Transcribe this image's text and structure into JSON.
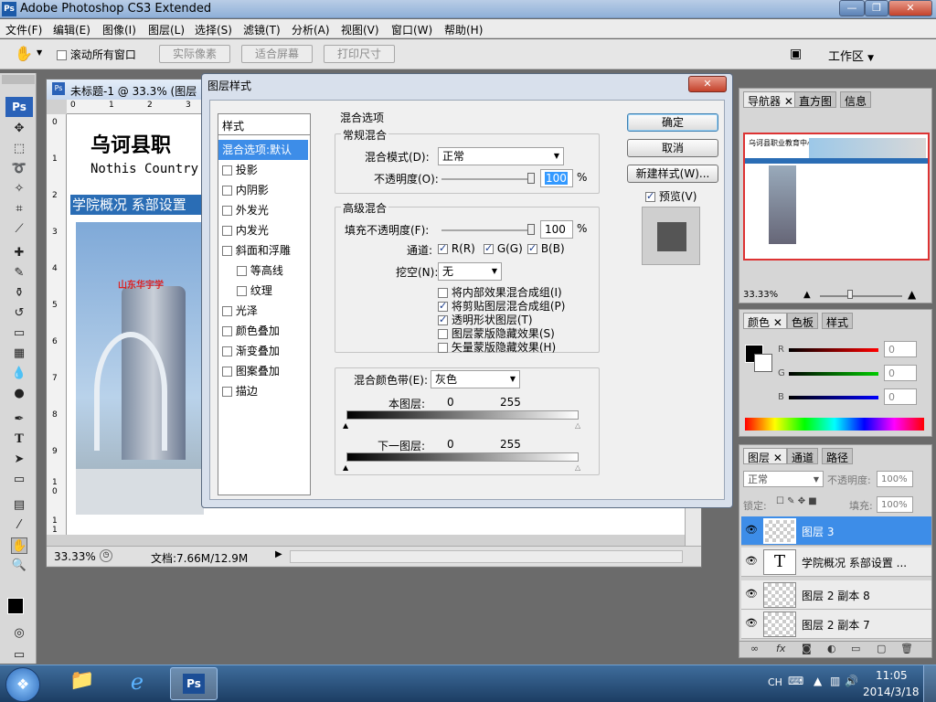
{
  "app": {
    "title": "Adobe Photoshop CS3 Extended",
    "logo": "Ps"
  },
  "window_controls": {
    "minimize": "—",
    "maximize": "❐",
    "close": "✕"
  },
  "menu": [
    "文件(F)",
    "编辑(E)",
    "图像(I)",
    "图层(L)",
    "选择(S)",
    "滤镜(T)",
    "分析(A)",
    "视图(V)",
    "窗口(W)",
    "帮助(H)"
  ],
  "options": {
    "scroll_all": "滚动所有窗口",
    "actual_pixels": "实际像素",
    "fit_screen": "适合屏幕",
    "print_size": "打印尺寸",
    "workspace": "工作区"
  },
  "document": {
    "tab_title": "未标题-1 @ 33.3% (图层",
    "heading_cn": "乌诃县职",
    "heading_en": "Nothis Country",
    "nav_text": "学院概况 系部设置",
    "building_sign": "山东华宇学",
    "zoom": "33.33%",
    "doc_size": "文档:7.66M/12.9M",
    "ruler_top": [
      "0",
      "1",
      "2",
      "3"
    ],
    "ruler_left": [
      "0",
      "1",
      "2",
      "3",
      "4",
      "5",
      "6",
      "7",
      "8",
      "9",
      "1\n0",
      "1\n1"
    ]
  },
  "dialog": {
    "title": "图层样式",
    "styles_header": "样式",
    "style_items": [
      {
        "label": "混合选项:默认",
        "checkbox": false,
        "selected": true
      },
      {
        "label": "投影",
        "checkbox": true
      },
      {
        "label": "内阴影",
        "checkbox": true
      },
      {
        "label": "外发光",
        "checkbox": true
      },
      {
        "label": "内发光",
        "checkbox": true
      },
      {
        "label": "斜面和浮雕",
        "checkbox": true
      },
      {
        "label": "等高线",
        "checkbox": true,
        "indent": true
      },
      {
        "label": "纹理",
        "checkbox": true,
        "indent": true
      },
      {
        "label": "光泽",
        "checkbox": true
      },
      {
        "label": "颜色叠加",
        "checkbox": true
      },
      {
        "label": "渐变叠加",
        "checkbox": true
      },
      {
        "label": "图案叠加",
        "checkbox": true
      },
      {
        "label": "描边",
        "checkbox": true
      }
    ],
    "blend_options": "混合选项",
    "general_blending": "常规混合",
    "blend_mode_label": "混合模式(D):",
    "blend_mode_value": "正常",
    "opacity_label": "不透明度(O):",
    "opacity_value": "100",
    "percent": "%",
    "advanced_blending": "高级混合",
    "fill_opacity_label": "填充不透明度(F):",
    "fill_opacity_value": "100",
    "channels_label": "通道:",
    "channel_r": "R(R)",
    "channel_g": "G(G)",
    "channel_b": "B(B)",
    "knockout_label": "挖空(N):",
    "knockout_value": "无",
    "check1": "将内部效果混合成组(I)",
    "check2": "将剪贴图层混合成组(P)",
    "check3": "透明形状图层(T)",
    "check4": "图层蒙版隐藏效果(S)",
    "check5": "矢量蒙版隐藏效果(H)",
    "blend_if_label": "混合颜色带(E):",
    "blend_if_value": "灰色",
    "this_layer": "本图层:",
    "underlying_layer": "下一图层:",
    "range_min": "0",
    "range_max": "255",
    "ok": "确定",
    "cancel": "取消",
    "new_style": "新建样式(W)...",
    "preview": "预览(V)"
  },
  "navigator": {
    "tabs": [
      "导航器",
      "直方图",
      "信息"
    ],
    "zoom": "33.33%",
    "thumb_title": "乌诃县职业教育中心"
  },
  "color_panel": {
    "tabs": [
      "颜色",
      "色板",
      "样式"
    ],
    "r_label": "R",
    "g_label": "G",
    "b_label": "B",
    "r": "0",
    "g": "0",
    "b": "0"
  },
  "layers_panel": {
    "tabs": [
      "图层",
      "通道",
      "路径"
    ],
    "blend_mode": "正常",
    "opacity_label": "不透明度:",
    "opacity": "100%",
    "lock_label": "锁定:",
    "fill_label": "填充:",
    "fill": "100%",
    "layers": [
      {
        "name": "图层 3",
        "selected": true
      },
      {
        "name": "学院概况 系部设置 ...",
        "type_layer": true,
        "type_glyph": "T"
      },
      {
        "name": "图层 2 副本 8"
      },
      {
        "name": "图层 2 副本 7"
      }
    ]
  },
  "taskbar": {
    "lang": "CH",
    "time": "11:05",
    "date": "2014/3/18"
  },
  "colors": {
    "accent": "#3399ff",
    "title_blue": "#8fb0d8",
    "dialog_bg": "#f0f0f0"
  }
}
